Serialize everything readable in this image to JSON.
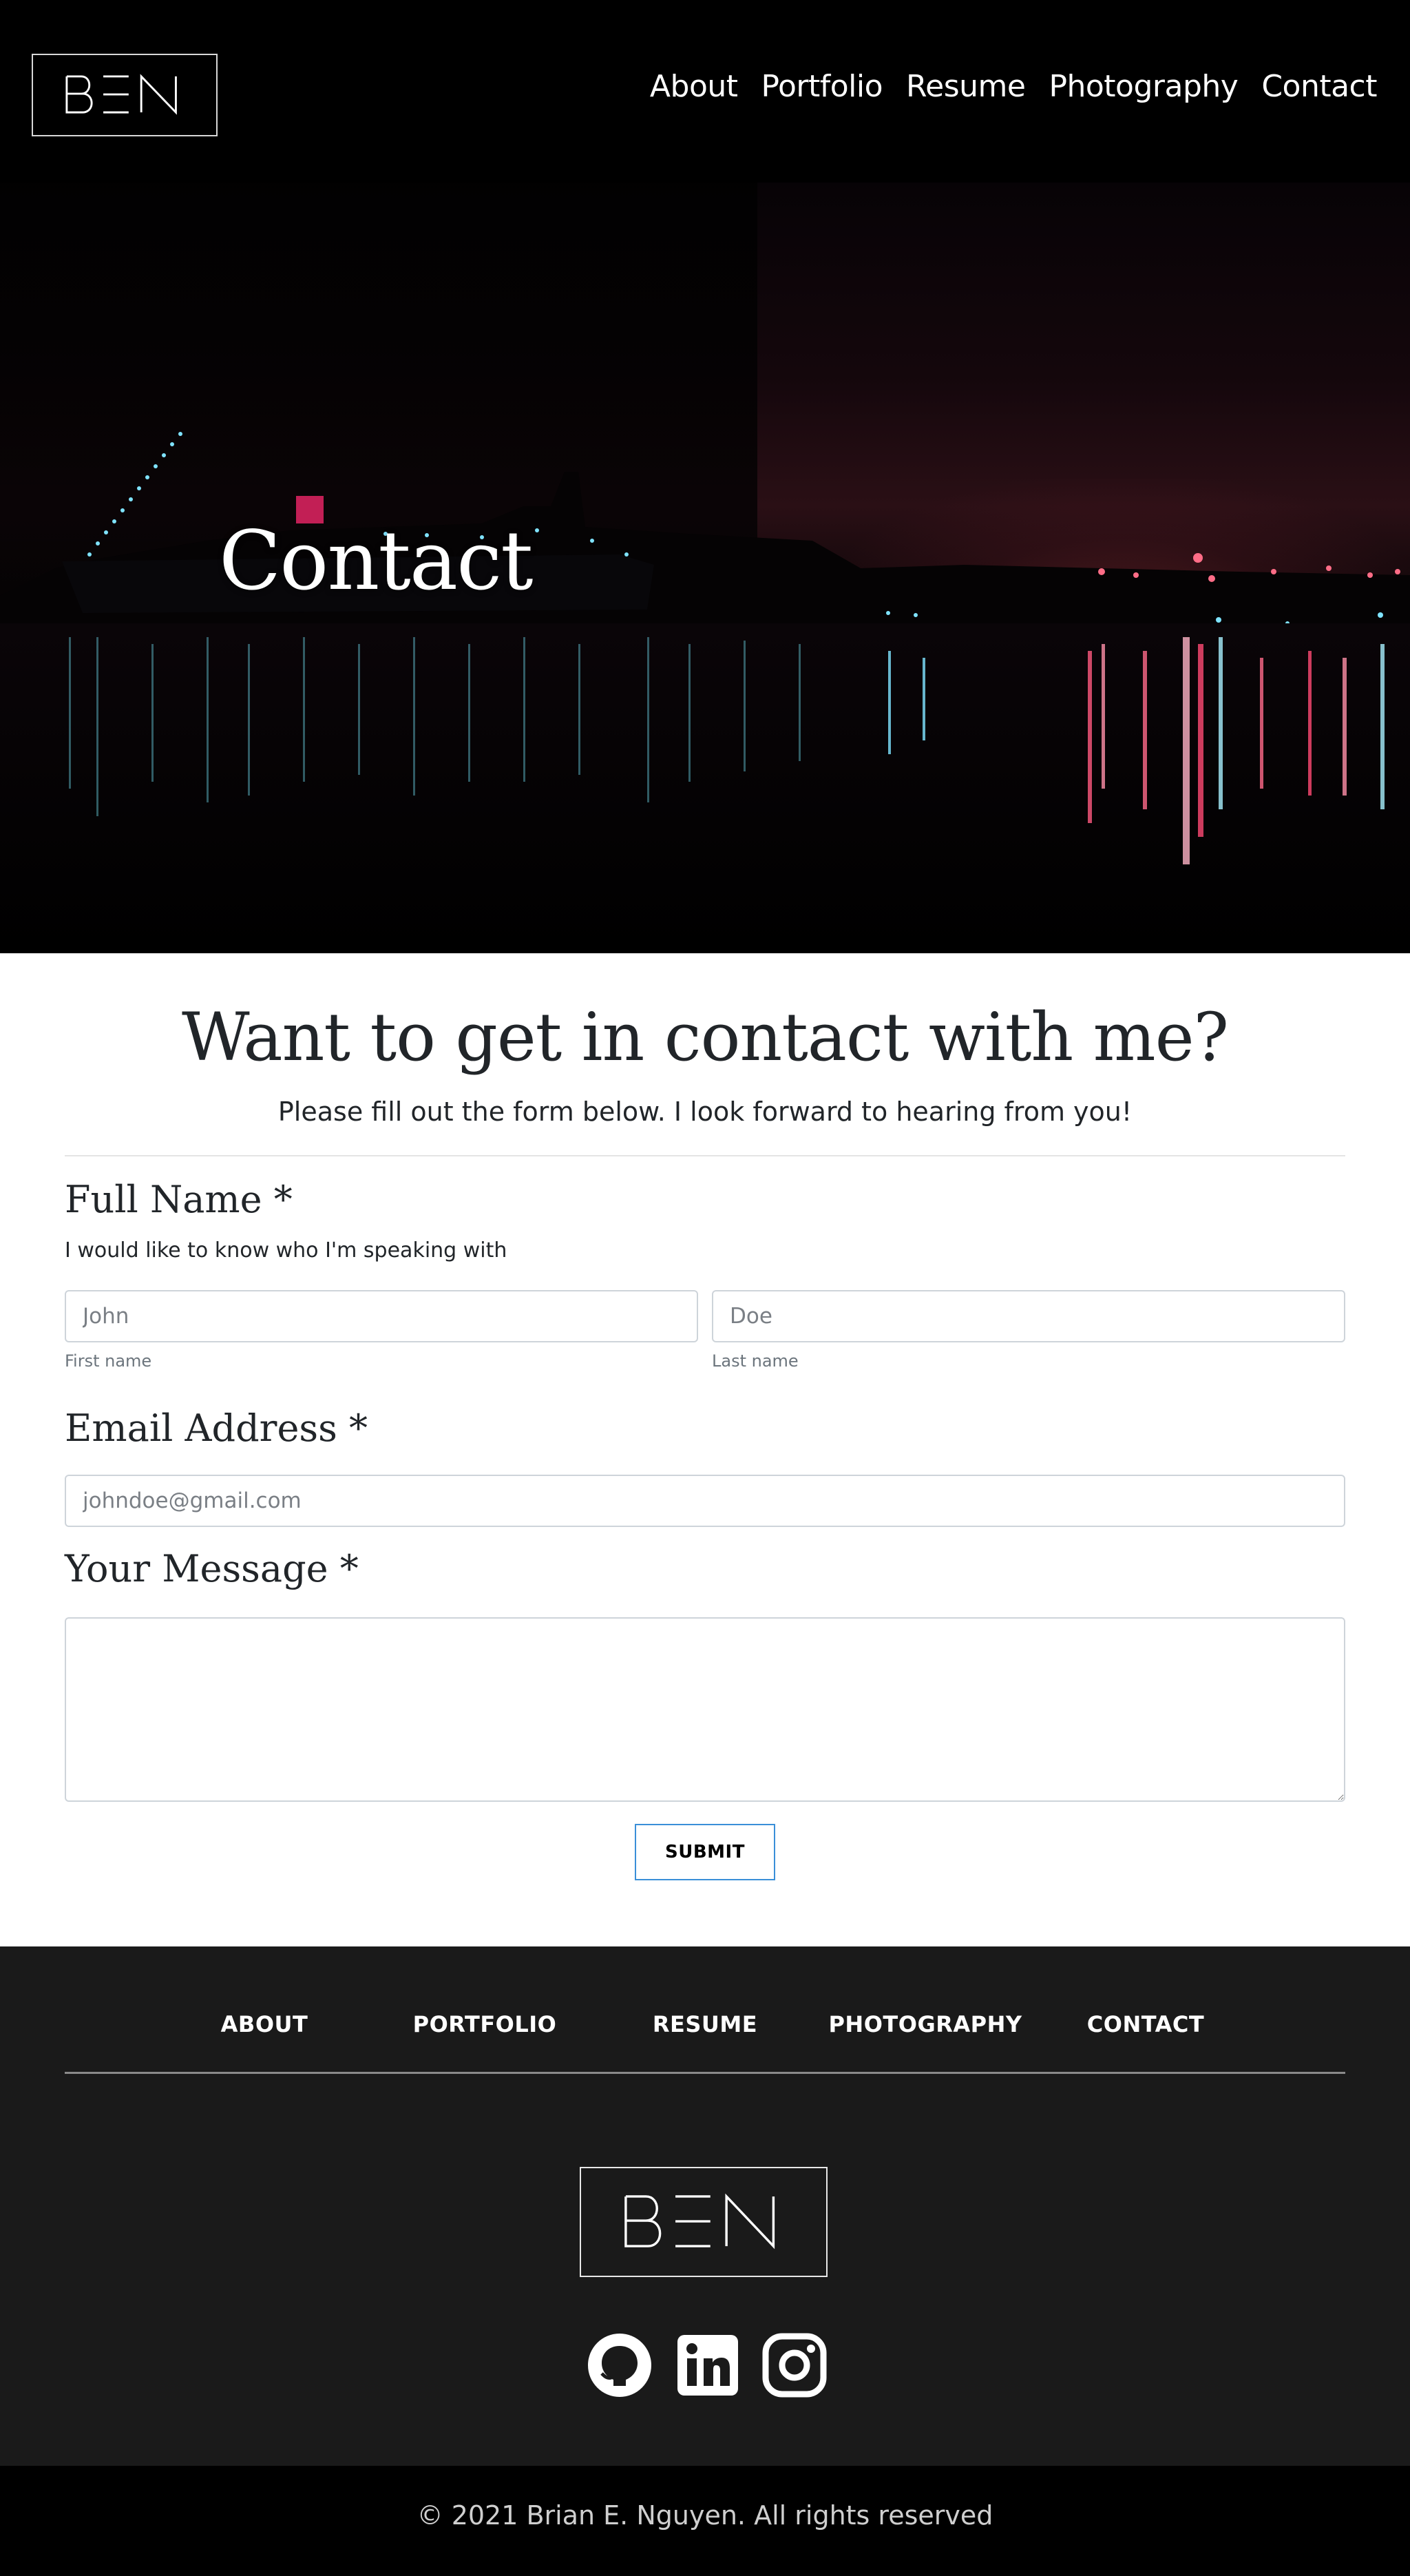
{
  "brand": {
    "logo_text": "BEN"
  },
  "nav": {
    "items": [
      "About",
      "Portfolio",
      "Resume",
      "Photography",
      "Contact"
    ]
  },
  "hero": {
    "title": "Contact"
  },
  "contact_form": {
    "heading": "Want to get in contact with me?",
    "subheading": "Please fill out the form below. I look forward to hearing from you!",
    "full_name": {
      "label": "Full Name *",
      "help": "I would like to know who I'm speaking with",
      "first_placeholder": "John",
      "first_sublabel": "First name",
      "last_placeholder": "Doe",
      "last_sublabel": "Last name"
    },
    "email": {
      "label": "Email Address *",
      "placeholder": "johndoe@gmail.com"
    },
    "message": {
      "label": "Your Message *",
      "value": ""
    },
    "submit_label": "SUBMIT"
  },
  "footer": {
    "links": [
      "ABOUT",
      "PORTFOLIO",
      "RESUME",
      "PHOTOGRAPHY",
      "CONTACT"
    ],
    "logo_text": "BEN",
    "social": [
      "github-icon",
      "linkedin-icon",
      "instagram-icon"
    ],
    "copyright": "© 2021 Brian E. Nguyen. All rights reserved"
  },
  "colors": {
    "nav_bg": "#000000",
    "footer_bg": "#1a1a1a",
    "submit_border": "#3a8fd8"
  }
}
